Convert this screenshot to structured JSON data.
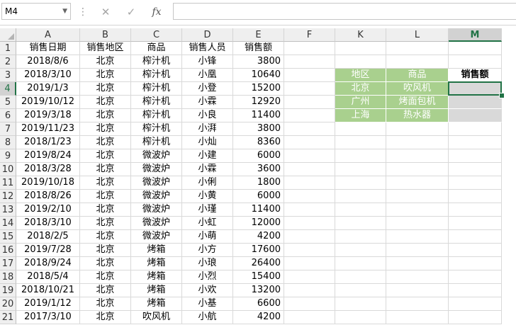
{
  "formula_bar": {
    "name_box": "M4",
    "cancel_icon": "✕",
    "enter_icon": "✓",
    "fx_label": "fx",
    "formula": ""
  },
  "columns": [
    "A",
    "B",
    "C",
    "D",
    "E",
    "F",
    "K",
    "L",
    "M"
  ],
  "selected_column": "M",
  "selected_row": 4,
  "rows": [
    [
      "销售日期",
      "销售地区",
      "商品",
      "销售人员",
      "销售额",
      "",
      "",
      "",
      ""
    ],
    [
      "2018/8/6",
      "北京",
      "榨汁机",
      "小锋",
      "3800",
      "",
      "",
      "",
      ""
    ],
    [
      "2018/3/10",
      "北京",
      "榨汁机",
      "小凰",
      "10640",
      "",
      "地区",
      "商品",
      "销售额"
    ],
    [
      "2019/1/3",
      "北京",
      "榨汁机",
      "小登",
      "15200",
      "",
      "北京",
      "吹风机",
      ""
    ],
    [
      "2019/10/12",
      "北京",
      "榨汁机",
      "小霖",
      "12920",
      "",
      "广州",
      "烤面包机",
      ""
    ],
    [
      "2019/3/18",
      "北京",
      "榨汁机",
      "小良",
      "11400",
      "",
      "上海",
      "热水器",
      ""
    ],
    [
      "2019/11/23",
      "北京",
      "榨汁机",
      "小湃",
      "3800",
      "",
      "",
      "",
      ""
    ],
    [
      "2018/1/23",
      "北京",
      "榨汁机",
      "小灿",
      "8360",
      "",
      "",
      "",
      ""
    ],
    [
      "2019/8/24",
      "北京",
      "微波炉",
      "小建",
      "6000",
      "",
      "",
      "",
      ""
    ],
    [
      "2018/3/28",
      "北京",
      "微波炉",
      "小霖",
      "3600",
      "",
      "",
      "",
      ""
    ],
    [
      "2019/10/18",
      "北京",
      "微波炉",
      "小俐",
      "1800",
      "",
      "",
      "",
      ""
    ],
    [
      "2018/8/26",
      "北京",
      "微波炉",
      "小黄",
      "6000",
      "",
      "",
      "",
      ""
    ],
    [
      "2019/2/10",
      "北京",
      "微波炉",
      "小瑾",
      "11400",
      "",
      "",
      "",
      ""
    ],
    [
      "2018/3/10",
      "北京",
      "微波炉",
      "小虹",
      "12000",
      "",
      "",
      "",
      ""
    ],
    [
      "2018/2/5",
      "北京",
      "微波炉",
      "小萌",
      "4200",
      "",
      "",
      "",
      ""
    ],
    [
      "2019/7/28",
      "北京",
      "烤箱",
      "小方",
      "17600",
      "",
      "",
      "",
      ""
    ],
    [
      "2018/9/24",
      "北京",
      "烤箱",
      "小琅",
      "26400",
      "",
      "",
      "",
      ""
    ],
    [
      "2018/5/4",
      "北京",
      "烤箱",
      "小烈",
      "15400",
      "",
      "",
      "",
      ""
    ],
    [
      "2018/10/21",
      "北京",
      "烤箱",
      "小欢",
      "13200",
      "",
      "",
      "",
      ""
    ],
    [
      "2019/1/12",
      "北京",
      "烤箱",
      "小基",
      "6600",
      "",
      "",
      "",
      ""
    ],
    [
      "2017/3/10",
      "北京",
      "吹风机",
      "小航",
      "4200",
      "",
      "",
      "",
      ""
    ]
  ],
  "colors": {
    "green_fill": "#a9d08e",
    "gray_fill": "#d9d9d9",
    "selection": "#217346"
  }
}
